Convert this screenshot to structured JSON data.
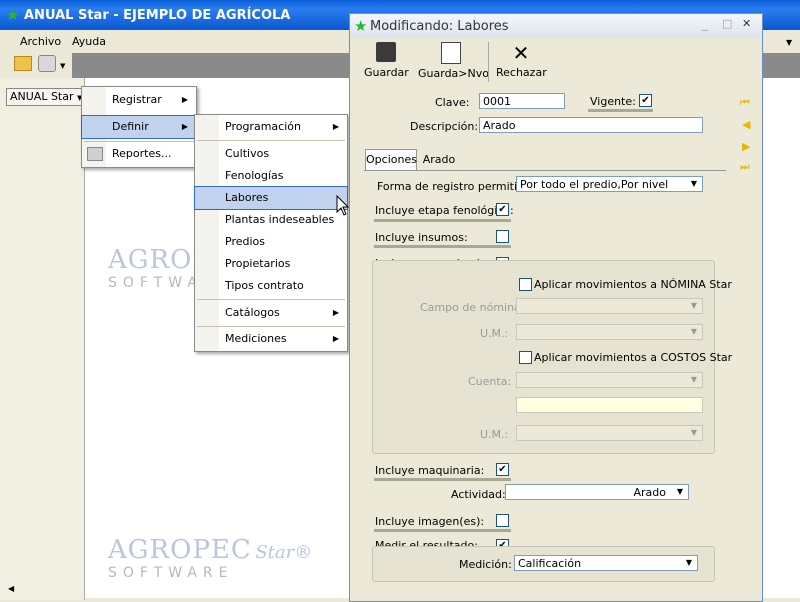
{
  "main_window": {
    "title": "ANUAL Star - EJEMPLO DE AGRÍCOLA"
  },
  "menubar": {
    "archivo": "Archivo",
    "ayuda": "Ayuda"
  },
  "sidebar": {
    "button": "ANUAL Star"
  },
  "watermark": {
    "brand": "AGROPEC",
    "star": "Star®",
    "software": "SOFTWARE"
  },
  "menu1": {
    "items": [
      "Registrar",
      "Definir",
      "Reportes..."
    ]
  },
  "menu2": {
    "items": [
      "Programación",
      "Cultivos",
      "Fenologías",
      "Labores",
      "Plantas indeseables",
      "Predios",
      "Propietarios",
      "Tipos contrato",
      "Catálogos",
      "Mediciones"
    ]
  },
  "dialog": {
    "title": "Modificando: Labores",
    "toolbar": {
      "guardar": "Guardar",
      "guardar_nvo": "Guarda>Nvo",
      "rechazar": "Rechazar"
    },
    "clave_label": "Clave:",
    "clave_value": "0001",
    "vigente_label": "Vigente:",
    "vigente_checked": true,
    "descripcion_label": "Descripción:",
    "descripcion_value": "Arado",
    "tabs": [
      "Opciones",
      "Arado"
    ],
    "forma_label": "Forma de registro permitida:",
    "forma_value": "Por todo el predio,Por nivel",
    "etapa_label": "Incluye etapa fenológica:",
    "etapa_checked": true,
    "insumos_label": "Incluye insumos:",
    "insumos_checked": false,
    "mano_label": "Incluye mano de obra:",
    "mano_checked": false,
    "nomina_label": "Aplicar movimientos a NÓMINA Star",
    "campo_label": "Campo de nómina:",
    "um_label": "U.M.:",
    "costos_label": "Aplicar movimientos a COSTOS Star",
    "cuenta_label": "Cuenta:",
    "maquinaria_label": "Incluye maquinaria:",
    "maquinaria_checked": true,
    "actividad_label": "Actividad:",
    "actividad_value": "Arado",
    "imagen_label": "Incluye imagen(es):",
    "imagen_checked": false,
    "medir_label": "Medir el resultado:",
    "medir_checked": true,
    "medicion_label": "Medición:",
    "medicion_value": "Calificación"
  },
  "colors": {
    "titlebar": "#0b58cf",
    "highlight": "#c1d2ee",
    "nav_arrows": "#e6b800"
  }
}
